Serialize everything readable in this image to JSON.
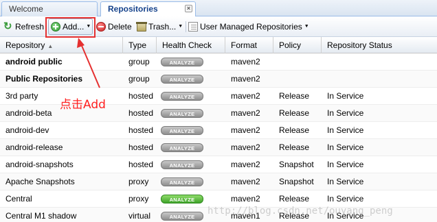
{
  "tabs": [
    {
      "label": "Welcome"
    },
    {
      "label": "Repositories"
    }
  ],
  "tab_close_glyph": "×",
  "toolbar": {
    "refresh_label": "Refresh",
    "add_label": "Add...",
    "delete_label": "Delete",
    "trash_label": "Trash...",
    "user_managed_label": "User Managed Repositories"
  },
  "columns": [
    "Repository",
    "Type",
    "Health Check",
    "Format",
    "Policy",
    "Repository Status"
  ],
  "analyze_label": "ANALYZE",
  "rows": [
    {
      "repository": "android public",
      "type": "group",
      "health": "gray",
      "format": "maven2",
      "policy": "",
      "status": ""
    },
    {
      "repository": "Public Repositories",
      "type": "group",
      "health": "gray",
      "format": "maven2",
      "policy": "",
      "status": ""
    },
    {
      "repository": "3rd party",
      "type": "hosted",
      "health": "gray",
      "format": "maven2",
      "policy": "Release",
      "status": "In Service"
    },
    {
      "repository": "android-beta",
      "type": "hosted",
      "health": "gray",
      "format": "maven2",
      "policy": "Release",
      "status": "In Service"
    },
    {
      "repository": "android-dev",
      "type": "hosted",
      "health": "gray",
      "format": "maven2",
      "policy": "Release",
      "status": "In Service"
    },
    {
      "repository": "android-release",
      "type": "hosted",
      "health": "gray",
      "format": "maven2",
      "policy": "Release",
      "status": "In Service"
    },
    {
      "repository": "android-snapshots",
      "type": "hosted",
      "health": "gray",
      "format": "maven2",
      "policy": "Snapshot",
      "status": "In Service"
    },
    {
      "repository": "Apache Snapshots",
      "type": "proxy",
      "health": "gray",
      "format": "maven2",
      "policy": "Snapshot",
      "status": "In Service"
    },
    {
      "repository": "Central",
      "type": "proxy",
      "health": "green",
      "format": "maven2",
      "policy": "Release",
      "status": "In Service"
    },
    {
      "repository": "Central M1 shadow",
      "type": "virtual",
      "health": "gray",
      "format": "maven1",
      "policy": "Release",
      "status": "In Service"
    }
  ],
  "annotation_text": "点击Add",
  "watermark": "http://blog.csdn.net/ouyang_peng",
  "colors": {
    "annotation": "#e53030",
    "accent": "#15428b",
    "analyze_green": "#3fa32a",
    "analyze_gray": "#8e8e8e"
  }
}
